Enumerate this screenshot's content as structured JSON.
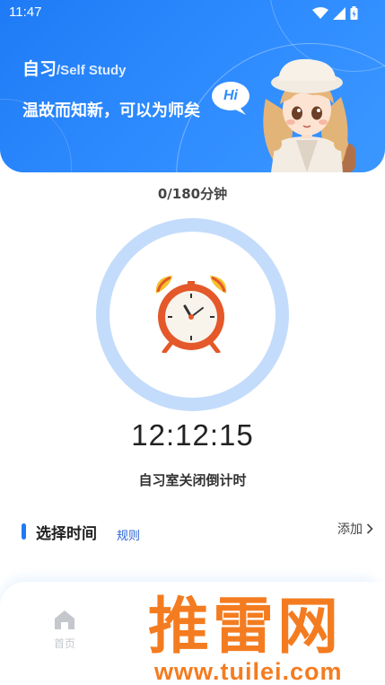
{
  "status_bar": {
    "time": "11:47"
  },
  "header": {
    "title": "自习",
    "title_en": "/Self Study",
    "subtitle": "温故而知新，可以为师矣",
    "bubble_text": "Hi"
  },
  "progress": {
    "text": "0/180分钟",
    "value": 0
  },
  "timer": {
    "display": "12:12:15",
    "label": "自习室关闭倒计时"
  },
  "select_time": {
    "title": "选择时间",
    "rules_label": "规则",
    "add_label": "添加"
  },
  "bottom_nav": {
    "home_label": "首页"
  },
  "watermark": {
    "text": "推雷网",
    "url": "www.tuilei.com"
  },
  "colors": {
    "primary": "#1f7bf5",
    "ring": "#c4dcfb",
    "watermark": "#f47c20"
  }
}
